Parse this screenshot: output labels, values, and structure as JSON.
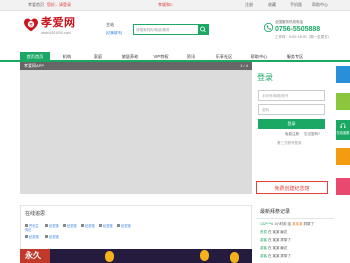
{
  "topbar": {
    "home": "孝爱首页",
    "auth": "您好，请登录",
    "slogan": "孝顺和C",
    "register": "注册",
    "bookmark": "收藏",
    "mobile": "手机版",
    "help": "帮助中心"
  },
  "brand": {
    "title": "孝爱网",
    "url": "www.5201000.com",
    "logo_char": "孝"
  },
  "location": {
    "name": "主站",
    "switch": "[切换城市]"
  },
  "search": {
    "placeholder": "请搜索机构/商品/服务"
  },
  "hotline": {
    "label": "全国服务热线电话",
    "number": "0756-5505888",
    "hours": "工作时：9:00~18:00（周一至周五）"
  },
  "nav": {
    "items": [
      "首页首页",
      "机构",
      "家庭",
      "旅居养老",
      "VIP特权",
      "资讯",
      "乐享社区",
      "帮助中心",
      "服务专区"
    ]
  },
  "banner": {
    "title": "孝爱网APP",
    "page": "1 / 4"
  },
  "login": {
    "title": "登录",
    "username_placeholder": "手机号/邮箱/账号",
    "password_placeholder": "密码",
    "submit": "登录",
    "register_link": "免费注册",
    "forgot_link": "忘记密码?",
    "third_party": "第三方账号登录"
  },
  "free_create": {
    "label": "免费创建纪念馆"
  },
  "online": {
    "title": "在线追思",
    "items": [
      "齐长生传记",
      "纪念馆",
      "纪念馆",
      "纪念馆",
      "纪念馆",
      "纪念馆",
      "纪念馆",
      "纪念馆"
    ]
  },
  "promo": {
    "text": "永久"
  },
  "records": {
    "title": "最新拜祭记录",
    "entries": [
      {
        "user": "132****6",
        "time": "1小时前 给",
        "target": "某某某",
        "action": "拜祭了"
      },
      {
        "user": "贵宾",
        "time": "",
        "target": "",
        "action": "在 某某 献花"
      },
      {
        "user": "游客",
        "time": "",
        "target": "",
        "action": "在 某某 拜祭了"
      },
      {
        "user": "游客",
        "time": "",
        "target": "",
        "action": "在 某某 献花"
      },
      {
        "user": "游客",
        "time": "",
        "target": "",
        "action": "在 某某 拜祭了"
      }
    ]
  },
  "side_rail": {
    "online_service": "在线客服"
  },
  "colors": {
    "brand_green": "#1aa864",
    "brand_red": "#c9151e",
    "rail_blue": "#2a8fd9",
    "rail_green": "#8cc63f",
    "rail_orange": "#f39c12",
    "rail_pink": "#e84a6f"
  }
}
